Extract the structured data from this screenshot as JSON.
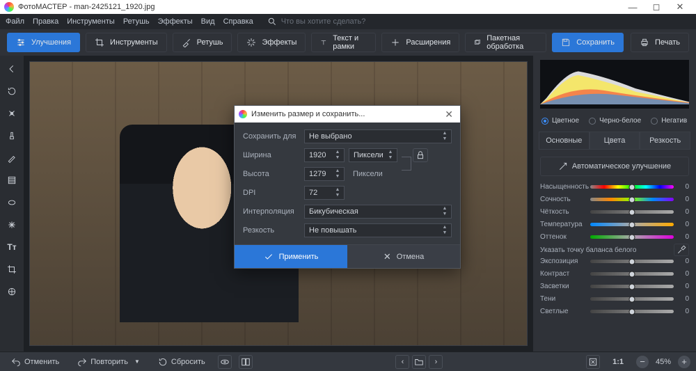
{
  "window": {
    "title": "ФотоМАСТЕР - man-2425121_1920.jpg"
  },
  "menu": [
    "Файл",
    "Правка",
    "Инструменты",
    "Ретушь",
    "Эффекты",
    "Вид",
    "Справка"
  ],
  "menu_search_placeholder": "Что вы хотите сделать?",
  "tabs": [
    {
      "icon": "sliders",
      "label": "Улучшения",
      "active": true
    },
    {
      "icon": "crop",
      "label": "Инструменты"
    },
    {
      "icon": "brush",
      "label": "Ретушь"
    },
    {
      "icon": "sparkle",
      "label": "Эффекты"
    },
    {
      "icon": "text",
      "label": "Текст и рамки"
    },
    {
      "icon": "plus",
      "label": "Расширения"
    },
    {
      "icon": "batch",
      "label": "Пакетная обработка"
    }
  ],
  "save_btn": "Сохранить",
  "print_btn": "Печать",
  "color_modes": [
    {
      "label": "Цветное",
      "selected": true
    },
    {
      "label": "Черно-белое",
      "selected": false
    },
    {
      "label": "Негатив",
      "selected": false
    }
  ],
  "subtabs": [
    {
      "label": "Основные",
      "active": true
    },
    {
      "label": "Цвета",
      "active": false
    },
    {
      "label": "Резкость",
      "active": false
    }
  ],
  "auto_enhance": "Автоматическое улучшение",
  "sliders1": [
    {
      "label": "Насыщенность",
      "value": "0",
      "grad": "grad-sat"
    },
    {
      "label": "Сочность",
      "value": "0",
      "grad": "grad-vib"
    },
    {
      "label": "Чёткость",
      "value": "0",
      "grad": "grad-gray"
    },
    {
      "label": "Температура",
      "value": "0",
      "grad": "grad-temp"
    },
    {
      "label": "Оттенок",
      "value": "0",
      "grad": "grad-tint"
    }
  ],
  "wb_label": "Указать точку баланса белого",
  "sliders2": [
    {
      "label": "Экспозиция",
      "value": "0",
      "grad": "grad-gray"
    },
    {
      "label": "Контраст",
      "value": "0",
      "grad": "grad-gray"
    },
    {
      "label": "Засветки",
      "value": "0",
      "grad": "grad-gray"
    },
    {
      "label": "Тени",
      "value": "0",
      "grad": "grad-gray"
    },
    {
      "label": "Светлые",
      "value": "0",
      "grad": "grad-gray"
    }
  ],
  "bottom": {
    "undo": "Отменить",
    "redo": "Повторить",
    "reset": "Сбросить",
    "ratio": "1:1",
    "zoom": "45%"
  },
  "dialog": {
    "title": "Изменить размер и сохранить...",
    "save_for": "Сохранить для",
    "save_for_value": "Не выбрано",
    "width_label": "Ширина",
    "width_value": "1920",
    "width_unit": "Пиксели",
    "height_label": "Высота",
    "height_value": "1279",
    "height_unit": "Пиксели",
    "dpi_label": "DPI",
    "dpi_value": "72",
    "interp_label": "Интерполяция",
    "interp_value": "Бикубическая",
    "sharp_label": "Резкость",
    "sharp_value": "Не повышать",
    "apply": "Применить",
    "cancel": "Отмена"
  }
}
